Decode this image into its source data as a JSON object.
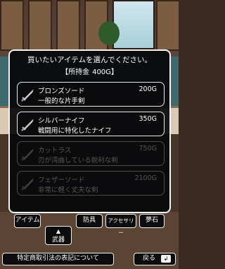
{
  "dialog": {
    "prompt": "買いたいアイテムを選んでください。",
    "money_label": "【所持金",
    "money_value": "400G】"
  },
  "items": [
    {
      "name": "ブロンズソード",
      "description": "一般的な片手剣",
      "price": "200G",
      "icon": "sword-icon",
      "enabled": true
    },
    {
      "name": "シルバーナイフ",
      "description": "戦闘用に特化したナイフ",
      "price": "350G",
      "icon": "sword-icon",
      "enabled": true
    },
    {
      "name": "カットラス",
      "description": "刃が湾曲している鋭利な剣",
      "price": "750G",
      "icon": "sword-icon",
      "enabled": false
    },
    {
      "name": "フェザーソード",
      "description": "非常に軽く丈夫な剣",
      "price": "2100G",
      "icon": "sword-icon",
      "enabled": false
    }
  ],
  "tabs": {
    "item": "アイテム",
    "weapon": "武器",
    "weapon_arrow": "▲",
    "armor": "防具",
    "accessory": "アクセサリー",
    "dream_stone": "夢石",
    "active": "weapon"
  },
  "footer": {
    "legal": "特定商取引法の表記について",
    "back": "戻る",
    "back_icon": "return-arrow-icon"
  },
  "colors": {
    "panel": "#0b0b0d",
    "border": "#eeeeee",
    "disabled_text": "#555555"
  }
}
